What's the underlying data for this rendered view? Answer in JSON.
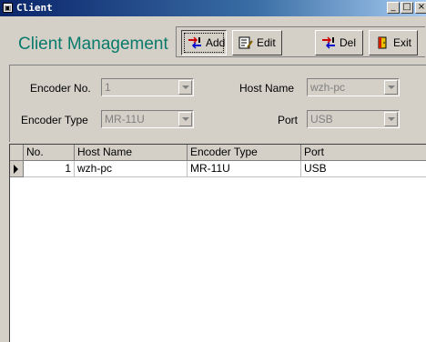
{
  "window": {
    "title": "Client"
  },
  "header": {
    "app_title": "Client Management"
  },
  "toolbar": {
    "add_label": "Add",
    "edit_label": "Edit",
    "del_label": "Del",
    "exit_label": "Exit"
  },
  "form": {
    "encoder_no_label": "Encoder No.",
    "encoder_no_value": "1",
    "host_name_label": "Host Name",
    "host_name_value": "wzh-pc",
    "encoder_type_label": "Encoder Type",
    "encoder_type_value": "MR-11U",
    "port_label": "Port",
    "port_value": "USB"
  },
  "table": {
    "columns": [
      "No.",
      "Host Name",
      "Encoder Type",
      "Port"
    ],
    "rows": [
      {
        "no": "1",
        "host_name": "wzh-pc",
        "encoder_type": "MR-11U",
        "port": "USB"
      }
    ]
  }
}
